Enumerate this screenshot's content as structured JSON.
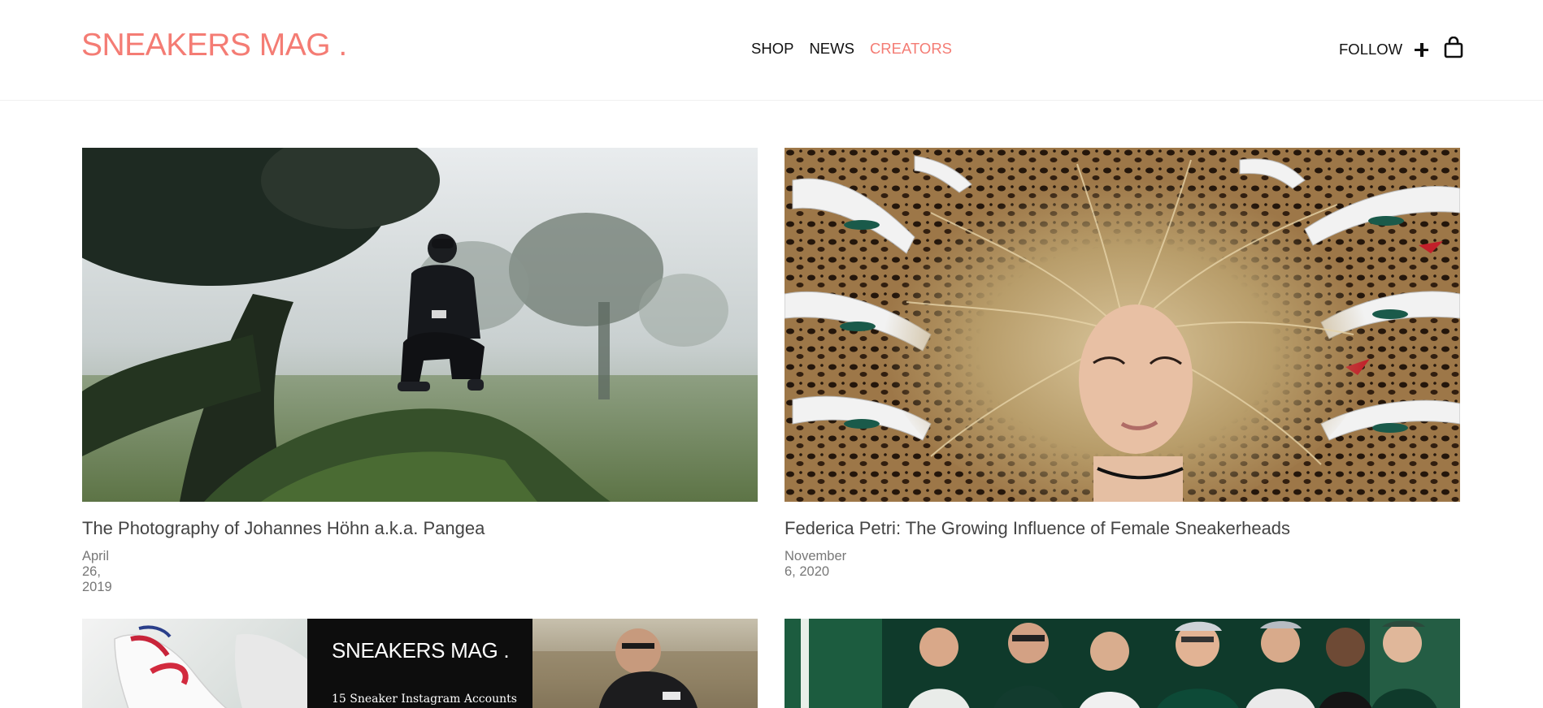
{
  "header": {
    "logo": "SNEAKERS MAG .",
    "nav": [
      {
        "label": "SHOP"
      },
      {
        "label": "NEWS"
      },
      {
        "label": "CREATORS",
        "active": true
      }
    ],
    "follow_label": "FOLLOW",
    "icons": [
      "plus-icon",
      "shopping-bag-icon"
    ]
  },
  "articles": [
    {
      "title": "The Photography of Johannes Höhn a.k.a. Pangea",
      "date": "April 26, 2019"
    },
    {
      "title": "Federica Petri: The Growing Influence of Female Sneakerheads",
      "date": "November 6, 2020"
    },
    {
      "title": "",
      "date": "",
      "overlay_brand": "SNEAKERS MAG .",
      "overlay_caption": "15 Sneaker Instagram Accounts"
    },
    {
      "title": "",
      "date": ""
    }
  ],
  "colors": {
    "accent": "#f47c74",
    "text": "#111111",
    "title": "#444444",
    "date": "#777777"
  }
}
